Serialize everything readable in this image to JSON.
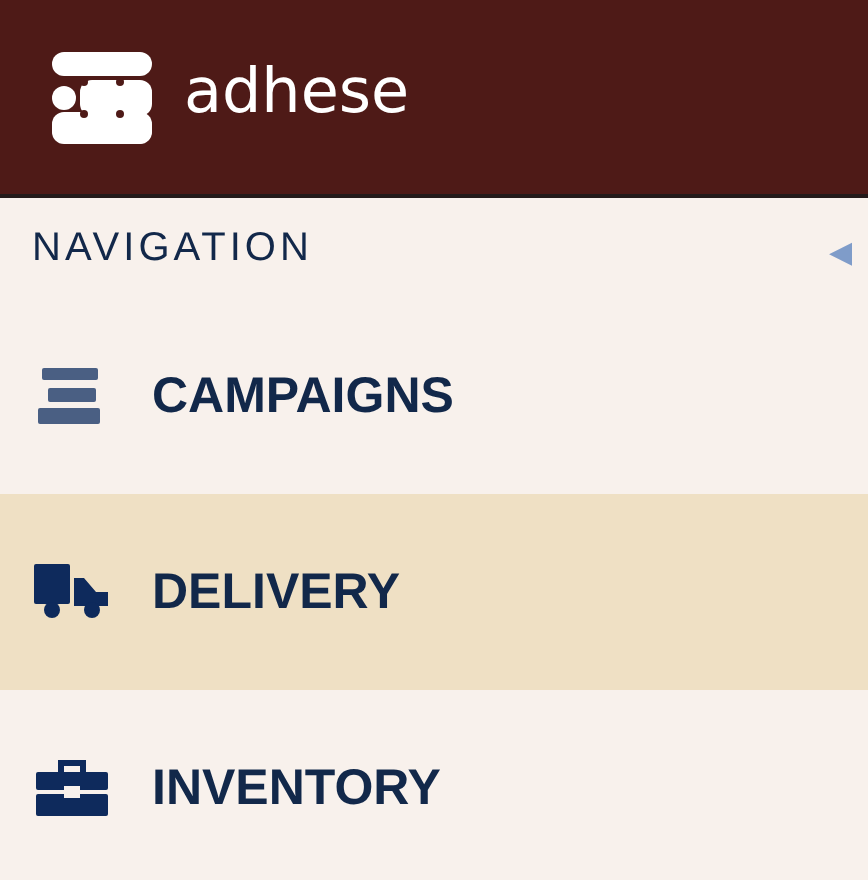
{
  "header": {
    "brand": "adhese"
  },
  "navigation": {
    "title": "NAVIGATION",
    "collapse_icon": "◀",
    "items": [
      {
        "label": "CAMPAIGNS",
        "kind": "campaigns",
        "selected": false
      },
      {
        "label": "DELIVERY",
        "kind": "delivery",
        "selected": true
      },
      {
        "label": "INVENTORY",
        "kind": "inventory",
        "selected": false
      }
    ]
  }
}
